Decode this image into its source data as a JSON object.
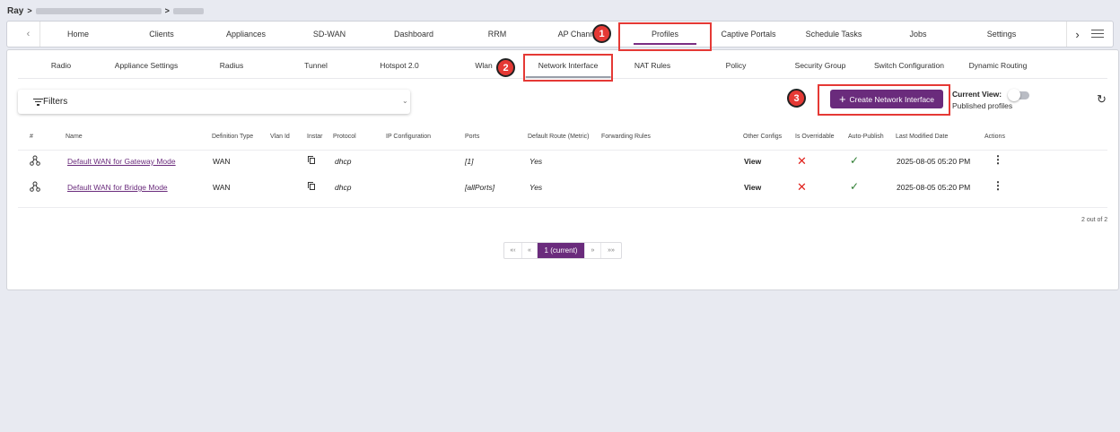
{
  "breadcrumb": {
    "root": "Ray",
    "separator": ">",
    "sep2": ">"
  },
  "top_nav": {
    "tabs": [
      "Home",
      "Clients",
      "Appliances",
      "SD-WAN",
      "Dashboard",
      "RRM",
      "AP Chann",
      "Profiles",
      "Captive Portals",
      "Schedule Tasks",
      "Jobs",
      "Settings"
    ],
    "active": "Profiles",
    "left_arrow": "‹",
    "right_arrow": "›",
    "icons": [
      "chevron-left-icon",
      "chevron-right-icon",
      "menu-icon"
    ]
  },
  "sub_nav": {
    "tabs": [
      "Radio",
      "Appliance Settings",
      "Radius",
      "Tunnel",
      "Hotspot 2.0",
      "Wlan",
      "Network Interface",
      "NAT Rules",
      "Policy",
      "Security Group",
      "Switch Configuration",
      "Dynamic Routing"
    ],
    "active": "Network Interface"
  },
  "filters": {
    "label": "Filters",
    "chevron": "⌄"
  },
  "toolbar": {
    "create_label": "Create Network Interface",
    "create_icon": "+",
    "current_view_label": "Current View:",
    "current_view_value": "Published profiles",
    "refresh_icon": "↻"
  },
  "table": {
    "columns": [
      "#",
      "Name",
      "Definition Type",
      "Vlan Id",
      "Instar",
      "Protocol",
      "IP Configuration",
      "Ports",
      "Default Route (Metric)",
      "Forwarding Rules",
      "Other Configs",
      "Is Overridable",
      "Auto-Publish",
      "Last Modified Date",
      "Actions"
    ],
    "rows": [
      {
        "name": "Default WAN for Gateway Mode",
        "definition_type": "WAN",
        "vlan_id": "",
        "protocol": "dhcp",
        "ip_configuration": "",
        "ports": "[1]",
        "default_route": "Yes",
        "forwarding_rules": "",
        "other_configs": "View",
        "is_overridable": "✕",
        "auto_publish": "✓",
        "last_modified": "2025-08-05 05:20 PM",
        "actions": "⋮"
      },
      {
        "name": "Default WAN for Bridge Mode",
        "definition_type": "WAN",
        "vlan_id": "",
        "protocol": "dhcp",
        "ip_configuration": "",
        "ports": "[allPorts]",
        "default_route": "Yes",
        "forwarding_rules": "",
        "other_configs": "View",
        "is_overridable": "✕",
        "auto_publish": "✓",
        "last_modified": "2025-08-05 05:20 PM",
        "actions": "⋮"
      }
    ],
    "count_text": "2 out of 2"
  },
  "pagination": {
    "first": "«‹",
    "prev": "«",
    "current": "1 (current)",
    "next": "»",
    "last": "»»"
  },
  "annotations": [
    "1",
    "2",
    "3"
  ],
  "colors": {
    "accent": "#6a2b7c",
    "highlight": "#e53935",
    "error": "#e0211c",
    "success": "#2e7d32"
  }
}
